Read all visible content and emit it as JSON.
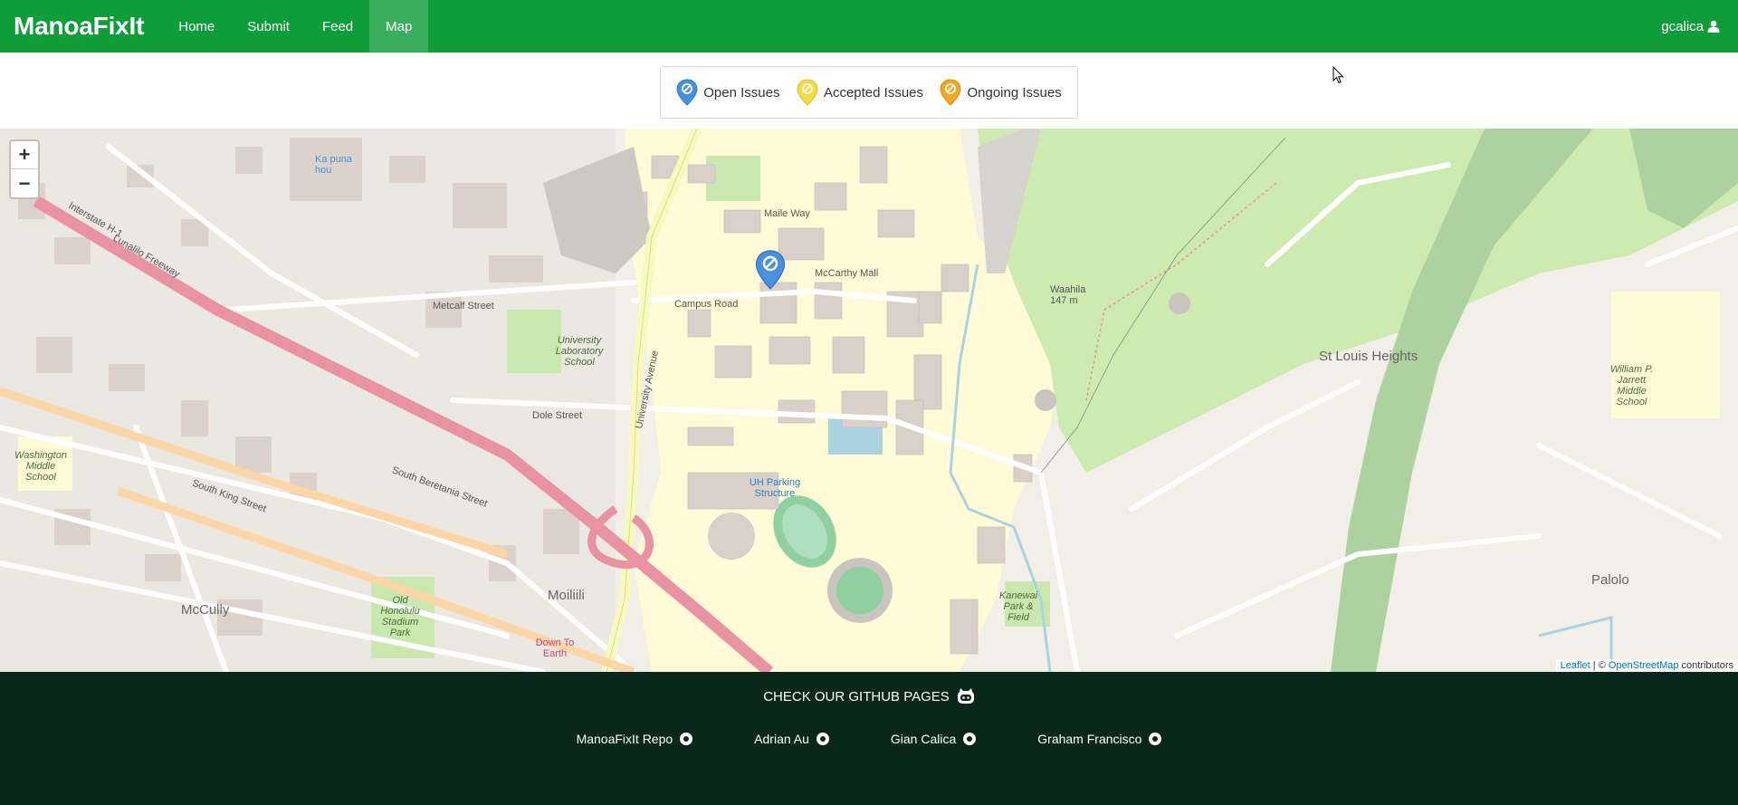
{
  "navbar": {
    "brand": "ManoaFixIt",
    "items": [
      {
        "label": "Home"
      },
      {
        "label": "Submit"
      },
      {
        "label": "Feed"
      },
      {
        "label": "Map"
      }
    ],
    "active": "Map",
    "user": "gcalica",
    "user_icon": "user-icon",
    "color": "#0f9d3a"
  },
  "legend": {
    "items": [
      {
        "label": "Open Issues",
        "icon": "blue-pin-icon",
        "color": "#4a90e2"
      },
      {
        "label": "Accepted Issues",
        "icon": "yellow-pin-icon",
        "color": "#f1dd3f"
      },
      {
        "label": "Ongoing Issues",
        "icon": "orange-pin-icon",
        "color": "#f5a623"
      }
    ]
  },
  "map": {
    "zoom_in": "+",
    "zoom_out": "−",
    "labels": {
      "st_louis_heights": "St Louis Heights",
      "palolo": "Palolo",
      "mccully": "McCully",
      "moiliili": "Moiliili",
      "university_lab_school": "University Laboratory School",
      "uh_parking": "UH Parking Structure",
      "waahila": "Waahila 147 m",
      "washington_middle": "Washington Middle School",
      "old_honolulu_stadium": "Old Honolulu Stadium Park",
      "kanewai": "Kanewai Park & Field",
      "jarrett": "William P. Jarrett Middle School",
      "down_to_earth": "Down To Earth",
      "campus_road": "Campus Road",
      "dole_street": "Dole Street",
      "university_avenue": "University Avenue",
      "lunalilo_freeway": "Lunalilo Freeway",
      "interstate": "Interstate H-1",
      "metcalf": "Metcalf Street",
      "mccarthy_mall": "McCarthy Mall",
      "maile_way": "Maile Way",
      "south_king": "South King Street",
      "south_beretania": "South Beretania Street",
      "kapiolani": "Ka puna hou"
    },
    "attribution": {
      "leaflet": "Leaflet",
      "sep": " | © ",
      "osm": "OpenStreetMap",
      "suffix": " contributors"
    },
    "marker_icon": "open-issue-marker-icon"
  },
  "footer": {
    "title": "CHECK OUR GITHUB PAGES",
    "title_icon": "github-octocat-icon",
    "links": [
      {
        "label": "ManoaFixIt Repo"
      },
      {
        "label": "Adrian Au"
      },
      {
        "label": "Gian Calica"
      },
      {
        "label": "Graham Francisco"
      }
    ],
    "color": "#09281b"
  }
}
